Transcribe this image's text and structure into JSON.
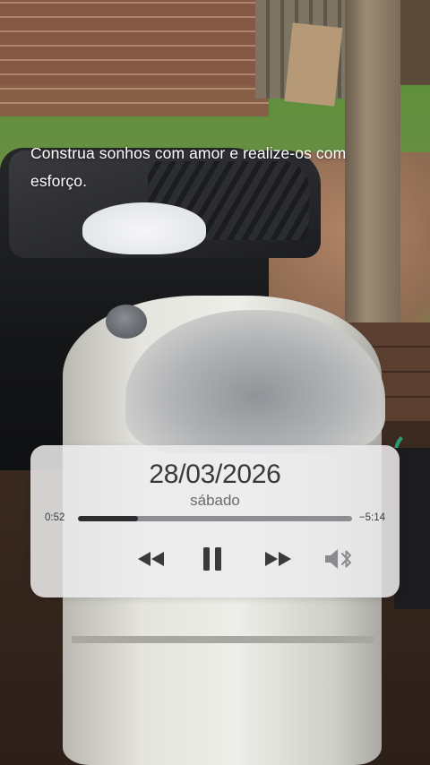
{
  "quote": {
    "text": "Construa sonhos com amor e realize-os com esforço."
  },
  "player": {
    "date": "28/03/2026",
    "weekday": "sábado",
    "elapsed": "0:52",
    "remaining": "−5:14",
    "progress_fraction": 0.22,
    "icons": {
      "rewind": "rewind-icon",
      "pause": "pause-icon",
      "forward": "fast-forward-icon",
      "audio_output": "bluetooth-speaker-icon"
    },
    "colors": {
      "card": "#eeecee",
      "text": "#3a3a3c",
      "track": "#8e8e92",
      "fill": "#2d2d30"
    }
  }
}
